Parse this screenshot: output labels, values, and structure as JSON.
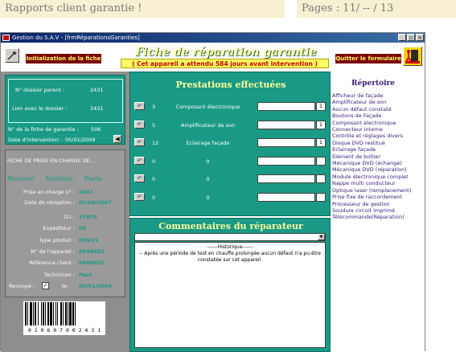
{
  "banner": {
    "left": "Rapports client garantie !",
    "right": "Pages : 11/ -- / 13"
  },
  "window": {
    "title": "Gestion du S.A.V - [frmRéparationsGaranties]",
    "minimize": "_",
    "restore": "▫",
    "close": "×"
  },
  "toolbar": {
    "init_label": "Initialization de la fiche",
    "quit_label": "Quitter le formulaire",
    "main_title": "Fiche de réparation garantie",
    "notice": "( Cet appareil a attendu 584 jours avant intervention )"
  },
  "dossier": {
    "parent_label": "N° dossier parent :",
    "parent_value": "2431",
    "lien_label": "Lien avec le dossier :",
    "lien_value": "2431",
    "fiche_label": "N° de la fiche de garantie :",
    "fiche_value": "506",
    "date_label": "Date d'intervention :",
    "date_value": "05/01/2009"
  },
  "prise": {
    "header": "FICHE DE PRISE EN CHARGE DE...",
    "civility": "Monsieur",
    "lastname": "Koskitalo",
    "firstname": "Pierre",
    "fields": [
      {
        "label": "Prise en charge n° :",
        "value": "2431"
      },
      {
        "label": "Date de réception :",
        "value": "01/06/2007"
      },
      {
        "label": "D.I :",
        "value": "17678"
      },
      {
        "label": "Expéditeur :",
        "value": "09"
      },
      {
        "label": "Type produit :",
        "value": "RDV21"
      },
      {
        "label": "N° de l'appareil :",
        "value": "8546852"
      },
      {
        "label": "Référence client :",
        "value": "8546852"
      },
      {
        "label": "Technicien :",
        "value": "Paul"
      }
    ],
    "renvoye_label": "Renvoyé :",
    "renvoye_check": "✓",
    "le_label": "le:",
    "renvoye_date": "05/01/2009",
    "barcode_text": "0 1 0 6 0 7 0 0 2 4 3 1"
  },
  "prestations": {
    "title": "Prestations effectuées",
    "rows": [
      {
        "qty": "3",
        "label": "Composant électronique",
        "count": "1"
      },
      {
        "qty": "5",
        "label": "Amplificateur de son",
        "count": "1"
      },
      {
        "qty": "12",
        "label": "Eclairage façade",
        "count": "1"
      },
      {
        "qty": "0",
        "label": "0",
        "count": ""
      },
      {
        "qty": "0",
        "label": "0",
        "count": ""
      },
      {
        "qty": "0",
        "label": "0",
        "count": ""
      }
    ]
  },
  "commentaires": {
    "title": "Commentaires du réparateur",
    "historique": "------Historique------",
    "text": "-- Après une période de test en chauffe prolongée aucun défaut n'a pu être constatée sur cet appareil."
  },
  "repertoire": {
    "title": "Répertoire",
    "items": [
      "Afficheur de façade",
      "Amplificateur de son",
      "Aucun défaut constaté",
      "Boutons de Façade",
      "Composant électronique",
      "Connecteur interne",
      "Contrôle et réglages divers",
      "Disque DVD restitué",
      "Eclairage façade",
      "Elément de boîtier",
      "Mécanique DVD (échange)",
      "Mécanique DVD (réparation)",
      "Module électronique complet",
      "Nappe multi conducteur",
      "Optique laser (remplacement)",
      "Prise fixe de raccordement",
      "Processeur de gestion",
      "Soudure circuit imprimé",
      "Télécommande(Réparation)"
    ]
  },
  "colors": {
    "teal": "#1a9a86",
    "banner": "#f7f0d2",
    "title_yellow": "#fffc9c",
    "repertoire": "#3b1a7a"
  }
}
